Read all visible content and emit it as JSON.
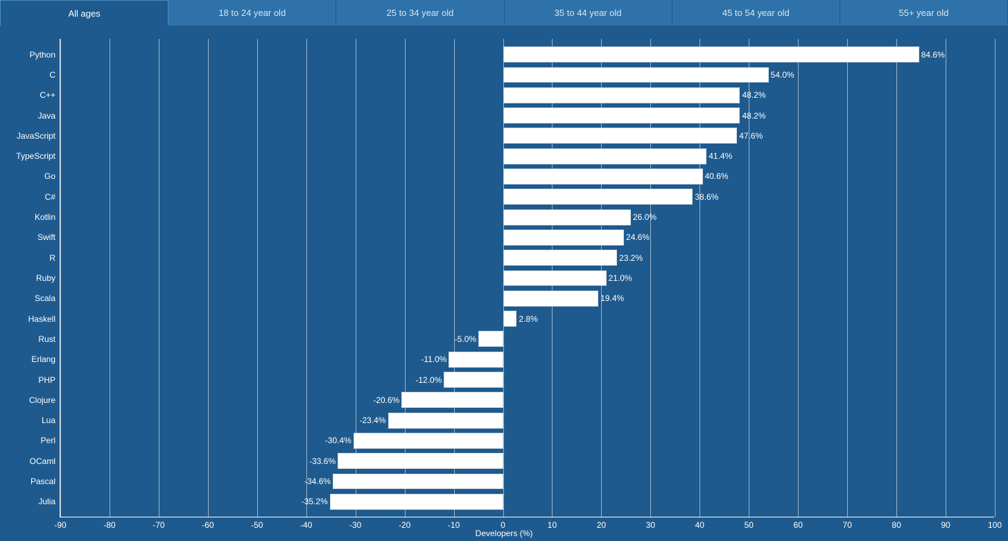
{
  "tabs": [
    {
      "label": "All ages",
      "active": true
    },
    {
      "label": "18 to 24 year old",
      "active": false
    },
    {
      "label": "25 to 34 year old",
      "active": false
    },
    {
      "label": "35 to 44 year old",
      "active": false
    },
    {
      "label": "45 to 54 year old",
      "active": false
    },
    {
      "label": "55+ year old",
      "active": false
    }
  ],
  "chart_data": {
    "type": "bar",
    "orientation": "horizontal",
    "categories": [
      "Python",
      "C",
      "C++",
      "Java",
      "JavaScript",
      "TypeScript",
      "Go",
      "C#",
      "Kotlin",
      "Swift",
      "R",
      "Ruby",
      "Scala",
      "Haskell",
      "Rust",
      "Erlang",
      "PHP",
      "Clojure",
      "Lua",
      "Perl",
      "OCaml",
      "Pascal",
      "Julia"
    ],
    "values": [
      84.6,
      54.0,
      48.2,
      48.2,
      47.6,
      41.4,
      40.6,
      38.6,
      26.0,
      24.6,
      23.2,
      21.0,
      19.4,
      2.8,
      -5.0,
      -11.0,
      -12.0,
      -20.6,
      -23.4,
      -30.4,
      -33.6,
      -34.6,
      -35.2
    ],
    "value_labels": [
      "84.6%",
      "54.0%",
      "48.2%",
      "48.2%",
      "47.6%",
      "41.4%",
      "40.6%",
      "38.6%",
      "26.0%",
      "24.6%",
      "23.2%",
      "21.0%",
      "19.4%",
      "2.8%",
      "-5.0%",
      "-11.0%",
      "-12.0%",
      "-20.6%",
      "-23.4%",
      "-30.4%",
      "-33.6%",
      "-34.6%",
      "-35.2%"
    ],
    "xlabel": "Developers (%)",
    "ylabel": "",
    "xlim": [
      -90,
      100
    ],
    "xticks": [
      -90,
      -80,
      -70,
      -60,
      -50,
      -40,
      -30,
      -20,
      -10,
      0,
      10,
      20,
      30,
      40,
      50,
      60,
      70,
      80,
      90,
      100
    ],
    "bar_color": "#ffffff",
    "background": "#1e5a8e"
  }
}
